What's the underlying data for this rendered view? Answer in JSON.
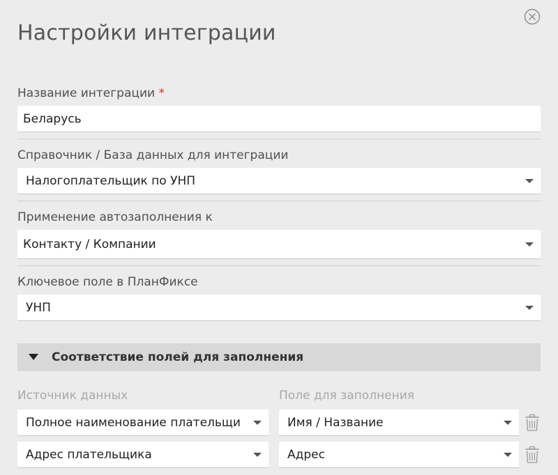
{
  "dialog": {
    "title": "Настройки интеграции"
  },
  "fields": {
    "integration_name": {
      "label": "Название интеграции",
      "required_mark": "*",
      "value": "Беларусь"
    },
    "directory": {
      "label": "Справочник / База данных для интеграции",
      "value": "Налогоплательщик по УНП"
    },
    "autofill_target": {
      "label": "Применение автозаполнения к",
      "value": "Контакту / Компании"
    },
    "key_field": {
      "label": "Ключевое поле в ПланФиксе",
      "value": "УНП"
    }
  },
  "mapping": {
    "section_title": "Соответствие полей для заполнения",
    "source_column_label": "Источник данных",
    "target_column_label": "Поле для заполнения",
    "rows": [
      {
        "source": "Полное наименование плательщи",
        "target": "Имя / Название"
      },
      {
        "source": "Адрес плательщика",
        "target": "Адрес"
      }
    ]
  },
  "colors": {
    "background": "#ececec",
    "required": "#d9342b",
    "section_header": "#d8d8d8"
  },
  "icons": [
    "close-circle-icon",
    "caret-down-icon",
    "triangle-down-icon",
    "trash-icon"
  ]
}
